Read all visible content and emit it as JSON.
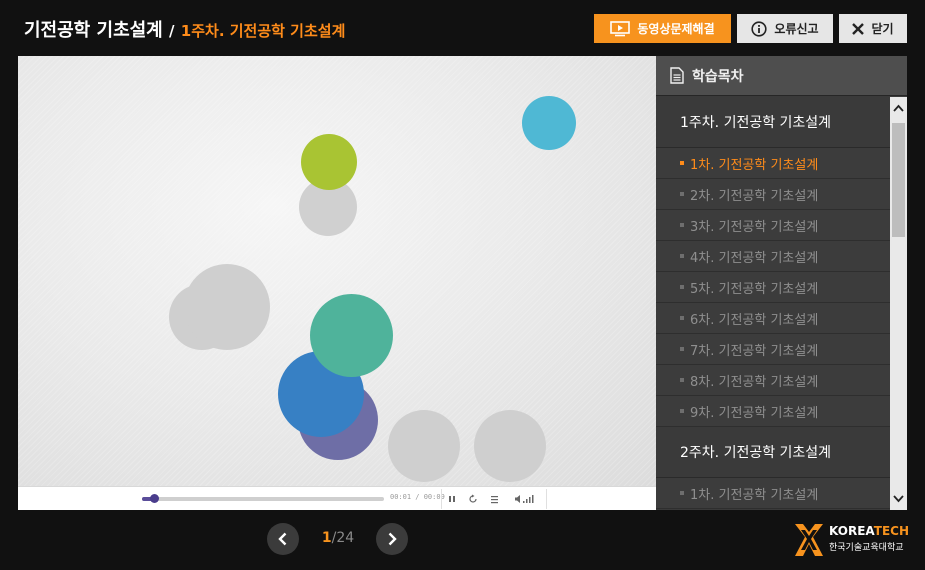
{
  "header": {
    "course_title": "기전공학 기초설계",
    "separator": "/",
    "lesson_title": "1주차. 기전공학 기초설계",
    "buttons": {
      "video_help": "동영상문제해결",
      "report_error": "오류신고",
      "close": "닫기"
    }
  },
  "player": {
    "time_display": "00:01 / 00:09",
    "progress_fraction": 0.05
  },
  "sidebar": {
    "title": "학습목차",
    "weeks": [
      {
        "label": "1주차. 기전공학 기초설계",
        "lessons": [
          "1차. 기전공학 기초설계",
          "2차. 기전공학 기초설계",
          "3차. 기전공학 기초설계",
          "4차. 기전공학 기초설계",
          "5차. 기전공학 기초설계",
          "6차. 기전공학 기초설계",
          "7차. 기전공학 기초설계",
          "8차. 기전공학 기초설계",
          "9차. 기전공학 기초설계"
        ]
      },
      {
        "label": "2주차. 기전공학 기초설계",
        "lessons": [
          "1차. 기전공학 기초설계"
        ]
      }
    ],
    "active_lesson": "1차. 기전공학 기초설계"
  },
  "pagination": {
    "current": "1",
    "total": "/24"
  },
  "logo": {
    "brand_left": "KOREA",
    "brand_right": "TECH",
    "subtitle": "한국기술교육대학교"
  },
  "colors": {
    "accent": "#f7931e",
    "circle_green": "#a9c433",
    "circle_cyan": "#4fb8d4",
    "circle_teal": "#4fb39b",
    "circle_blue": "#3780c4",
    "circle_purple": "#6e6ea6",
    "circle_gray": "#cfcfcf"
  }
}
